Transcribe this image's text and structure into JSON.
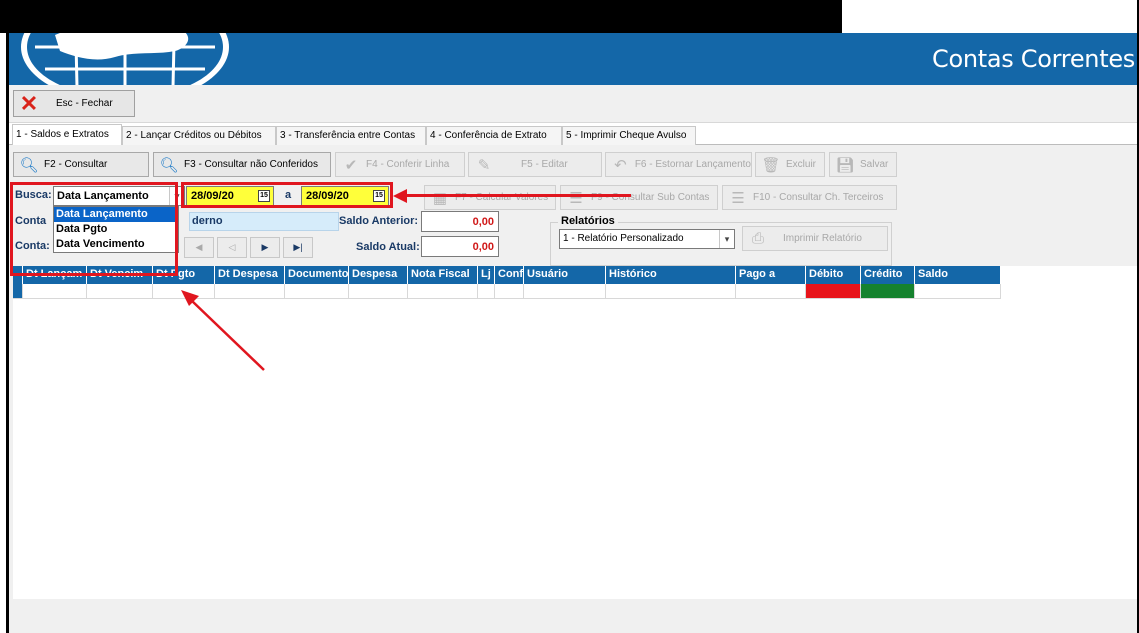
{
  "window": {
    "title": "Contas Correntes"
  },
  "toolbar": {
    "close_label": "Esc - Fechar"
  },
  "tabs": [
    {
      "label": "1 - Saldos e Extratos"
    },
    {
      "label": "2 - Lançar Créditos ou Débitos"
    },
    {
      "label": "3 - Transferência entre Contas"
    },
    {
      "label": "4 - Conferência de Extrato"
    },
    {
      "label": "5 - Imprimir Cheque Avulso"
    }
  ],
  "actions": {
    "consultar": "F2 - Consultar",
    "consultar_nao_conferidos": "F3 - Consultar não Conferidos",
    "conferir_linha": "F4 - Conferir Linha",
    "editar": "F5 - Editar",
    "estornar": "F6 - Estornar Lançamento",
    "excluir": "Excluir",
    "salvar": "Salvar",
    "calcular": "F7 - Calcular Valores",
    "sub_contas": "F9 - Consultar Sub Contas",
    "ch_terceiros": "F10 - Consultar Ch. Terceiros"
  },
  "filter": {
    "busca_label": "Busca:",
    "busca_value": "Data Lançamento",
    "date_from": "28/09/20",
    "date_sep": "a",
    "date_to": "28/09/20",
    "options": [
      "Data Lançamento",
      "Data Pgto",
      "Data Vencimento"
    ]
  },
  "conta": {
    "conta_label": "Conta",
    "conta_label2": "Conta:",
    "conta_value": "derno",
    "saldo_anterior_label": "Saldo Anterior:",
    "saldo_anterior": "0,00",
    "saldo_atual_label": "Saldo Atual:",
    "saldo_atual": "0,00"
  },
  "relatorios": {
    "title": "Relatórios",
    "selected": "1 - Relatório Personalizado",
    "print_label": "Imprimir Relatório"
  },
  "grid": {
    "columns": [
      "Dt Lançam",
      "Dt Vencim",
      "Dt Pgto",
      "Dt Despesa",
      "Documento",
      "Despesa",
      "Nota Fiscal",
      "Lj",
      "Conf",
      "Usuário",
      "Histórico",
      "Pago a",
      "Débito",
      "Crédito",
      "Saldo"
    ]
  },
  "colors": {
    "header_blue": "#1467a8",
    "debit": "#e8141a",
    "credit": "#15822e",
    "highlight": "#e0161f"
  }
}
